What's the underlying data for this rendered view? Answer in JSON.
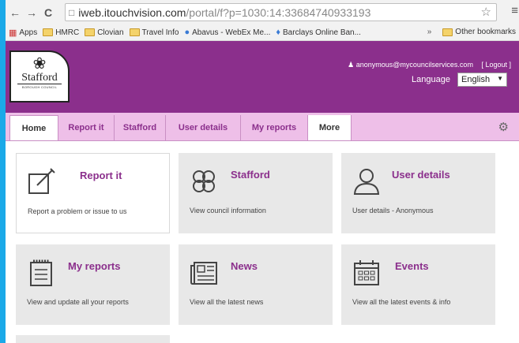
{
  "browser": {
    "url_host": "iweb.itouchvision.com",
    "url_path": "/portal/f?p=1030:14:33684740933193",
    "bookmarks": [
      "Apps",
      "HMRC",
      "Clovian",
      "Travel Info",
      "Abavus - WebEx Me...",
      "Barclays Online Ban..."
    ],
    "overflow": "»",
    "other_bookmarks": "Other bookmarks"
  },
  "header": {
    "logo_name": "Stafford",
    "logo_sub": "BOROUGH COUNCIL",
    "user_email": "anonymous@mycouncilservices.com",
    "logout": "[ Logout ]",
    "language_label": "Language",
    "language_value": "English"
  },
  "tabs": [
    "Home",
    "Report it",
    "Stafford",
    "User details",
    "My reports",
    "More"
  ],
  "tiles": [
    {
      "title": "Report it",
      "desc": "Report a problem or issue to us",
      "icon": "edit-icon"
    },
    {
      "title": "Stafford",
      "desc": "View council information",
      "icon": "stafford-knot-icon"
    },
    {
      "title": "User details",
      "desc": "User details - Anonymous",
      "icon": "user-icon"
    },
    {
      "title": "My reports",
      "desc": "View and update all your reports",
      "icon": "notepad-icon"
    },
    {
      "title": "News",
      "desc": "View all the latest news",
      "icon": "newspaper-icon"
    },
    {
      "title": "Events",
      "desc": "View all the latest events & info",
      "icon": "calendar-icon"
    }
  ],
  "colors": {
    "brand": "#8b2f8c",
    "tab_bar": "#eebfe8",
    "tile": "#e8e8e8"
  }
}
